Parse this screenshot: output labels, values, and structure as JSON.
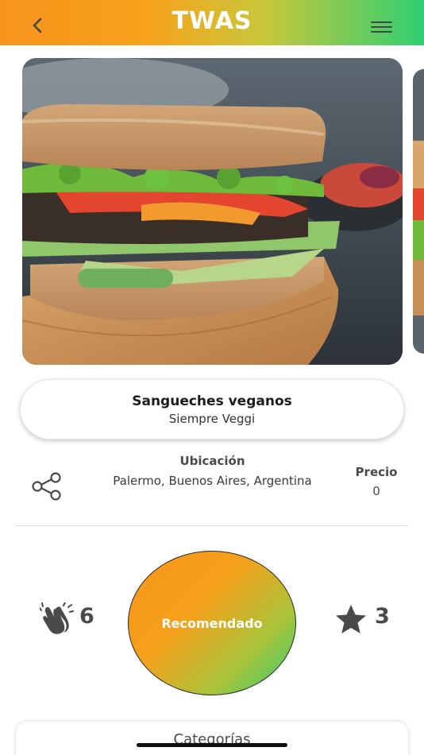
{
  "header": {
    "title": "TWAS",
    "back_icon": "chevron-left-icon",
    "menu_icon": "hamburger-menu-icon"
  },
  "carousel": {
    "images": [
      {
        "alt": "Sandwich vegano con pan de semillas, hamburguesa de lentejas, morrón asado, brotes, palta y pepino"
      },
      {
        "alt": "Siguiente imagen"
      }
    ]
  },
  "place": {
    "name": "Sangueches veganos",
    "subtitle": "Siempre Veggi"
  },
  "details": {
    "location_label": "Ubicación",
    "location_value": "Palermo, Buenos Aires, Argentina",
    "price_label": "Precio",
    "price_value": "0",
    "share_icon": "share-icon"
  },
  "actions": {
    "claps": "6",
    "recommend_label": "Recomendado",
    "stars": "3",
    "clap_icon": "clapping-hands-icon",
    "star_icon": "star-icon"
  },
  "categories": {
    "title": "Categorías"
  },
  "colors": {
    "gradient_start": "#f7941d",
    "gradient_end": "#2fcf72",
    "icon_gray": "#4a4a4a"
  }
}
